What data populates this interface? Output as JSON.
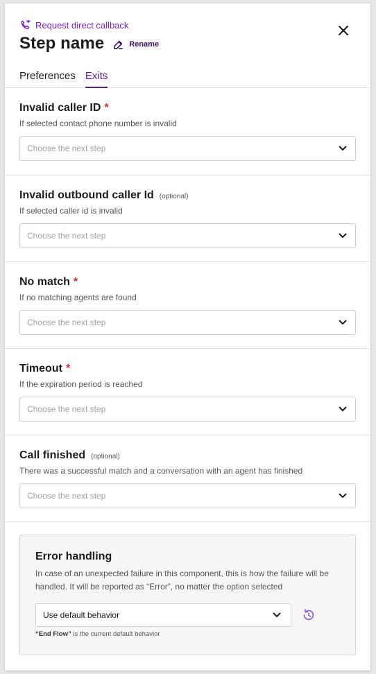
{
  "header": {
    "step_type": "Request direct callback",
    "title": "Step name",
    "rename_label": "Rename"
  },
  "tabs": [
    {
      "label": "Preferences",
      "active": false
    },
    {
      "label": "Exits",
      "active": true
    }
  ],
  "exits": [
    {
      "title": "Invalid caller ID",
      "required": "*",
      "optional": "",
      "description": "If selected contact phone number is invalid",
      "placeholder": "Choose the next step"
    },
    {
      "title": "Invalid outbound caller Id",
      "required": "",
      "optional": "(optional)",
      "description": "If selected caller id is invalid",
      "placeholder": "Choose the next step"
    },
    {
      "title": "No match",
      "required": "*",
      "optional": "",
      "description": "If no matching agents are found",
      "placeholder": "Choose the next step"
    },
    {
      "title": "Timeout",
      "required": "*",
      "optional": "",
      "description": "If the expiration period is reached",
      "placeholder": "Choose the next step"
    },
    {
      "title": "Call finished",
      "required": "",
      "optional": "(optional)",
      "description": "There was a successful match and a conversation with an agent has finished",
      "placeholder": "Choose the next step"
    }
  ],
  "error_handling": {
    "title": "Error handling",
    "description": "In case of an unexpected failure in this component, this is how the failure will be handled. It will be reported as “Error”, no matter the option selected",
    "selected": "Use default behavior",
    "note_strong": "“End Flow”",
    "note_rest": " is the current default behavior"
  },
  "icons": {
    "step_type": "phone-callback-icon",
    "rename": "pencil-icon",
    "close": "close-icon",
    "dropdown": "chevron-down-icon",
    "reset": "reset-icon"
  },
  "colors": {
    "accent": "#5a1aa8",
    "step_type": "#7a1fd6",
    "required": "#d6262c"
  }
}
